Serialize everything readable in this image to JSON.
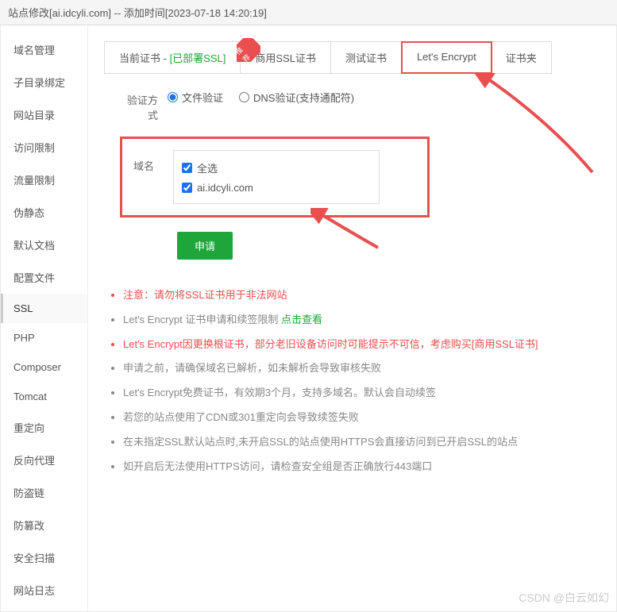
{
  "header": {
    "title": "站点修改[ai.idcyli.com] -- 添加时间[2023-07-18 14:20:19]"
  },
  "sidebar": {
    "items": [
      {
        "label": "域名管理"
      },
      {
        "label": "子目录绑定"
      },
      {
        "label": "网站目录"
      },
      {
        "label": "访问限制"
      },
      {
        "label": "流量限制"
      },
      {
        "label": "伪静态"
      },
      {
        "label": "默认文档"
      },
      {
        "label": "配置文件"
      },
      {
        "label": "SSL",
        "active": true
      },
      {
        "label": "PHP"
      },
      {
        "label": "Composer"
      },
      {
        "label": "Tomcat"
      },
      {
        "label": "重定向"
      },
      {
        "label": "反向代理"
      },
      {
        "label": "防盗链"
      },
      {
        "label": "防篡改"
      },
      {
        "label": "安全扫描"
      },
      {
        "label": "网站日志"
      }
    ]
  },
  "tabs": [
    {
      "label": "当前证书 - ",
      "suffix": "[已部署SSL]"
    },
    {
      "label": "商用SSL证书",
      "ribbon": true
    },
    {
      "label": "测试证书"
    },
    {
      "label": "Let's Encrypt",
      "highlighted": true
    },
    {
      "label": "证书夹"
    }
  ],
  "form": {
    "verify_label": "验证方式",
    "verify_options": {
      "file": "文件验证",
      "dns": "DNS验证(支持通配符)"
    },
    "domain_label": "域名",
    "select_all": "全选",
    "domains": [
      "ai.idcyli.com"
    ],
    "apply_button": "申请"
  },
  "notes": [
    {
      "text": "注意：请勿将SSL证书用于非法网站",
      "warning": true
    },
    {
      "text": "Let's Encrypt 证书申请和续签限制 ",
      "link": "点击查看"
    },
    {
      "text": "Let's Encrypt因更换根证书，部分老旧设备访问时可能提示不可信，考虑购买",
      "redlink": "[商用SSL证书]",
      "warning": true
    },
    {
      "text": "申请之前，请确保域名已解析，如未解析会导致审核失败"
    },
    {
      "text": "Let's Encrypt免费证书，有效期3个月，支持多域名。默认会自动续签"
    },
    {
      "text": "若您的站点使用了CDN或301重定向会导致续签失败"
    },
    {
      "text": "在未指定SSL默认站点时,未开启SSL的站点使用HTTPS会直接访问到已开启SSL的站点"
    },
    {
      "text": "如开启后无法使用HTTPS访问，请检查安全组是否正确放行443端口"
    }
  ],
  "watermark": "CSDN @白云如幻"
}
